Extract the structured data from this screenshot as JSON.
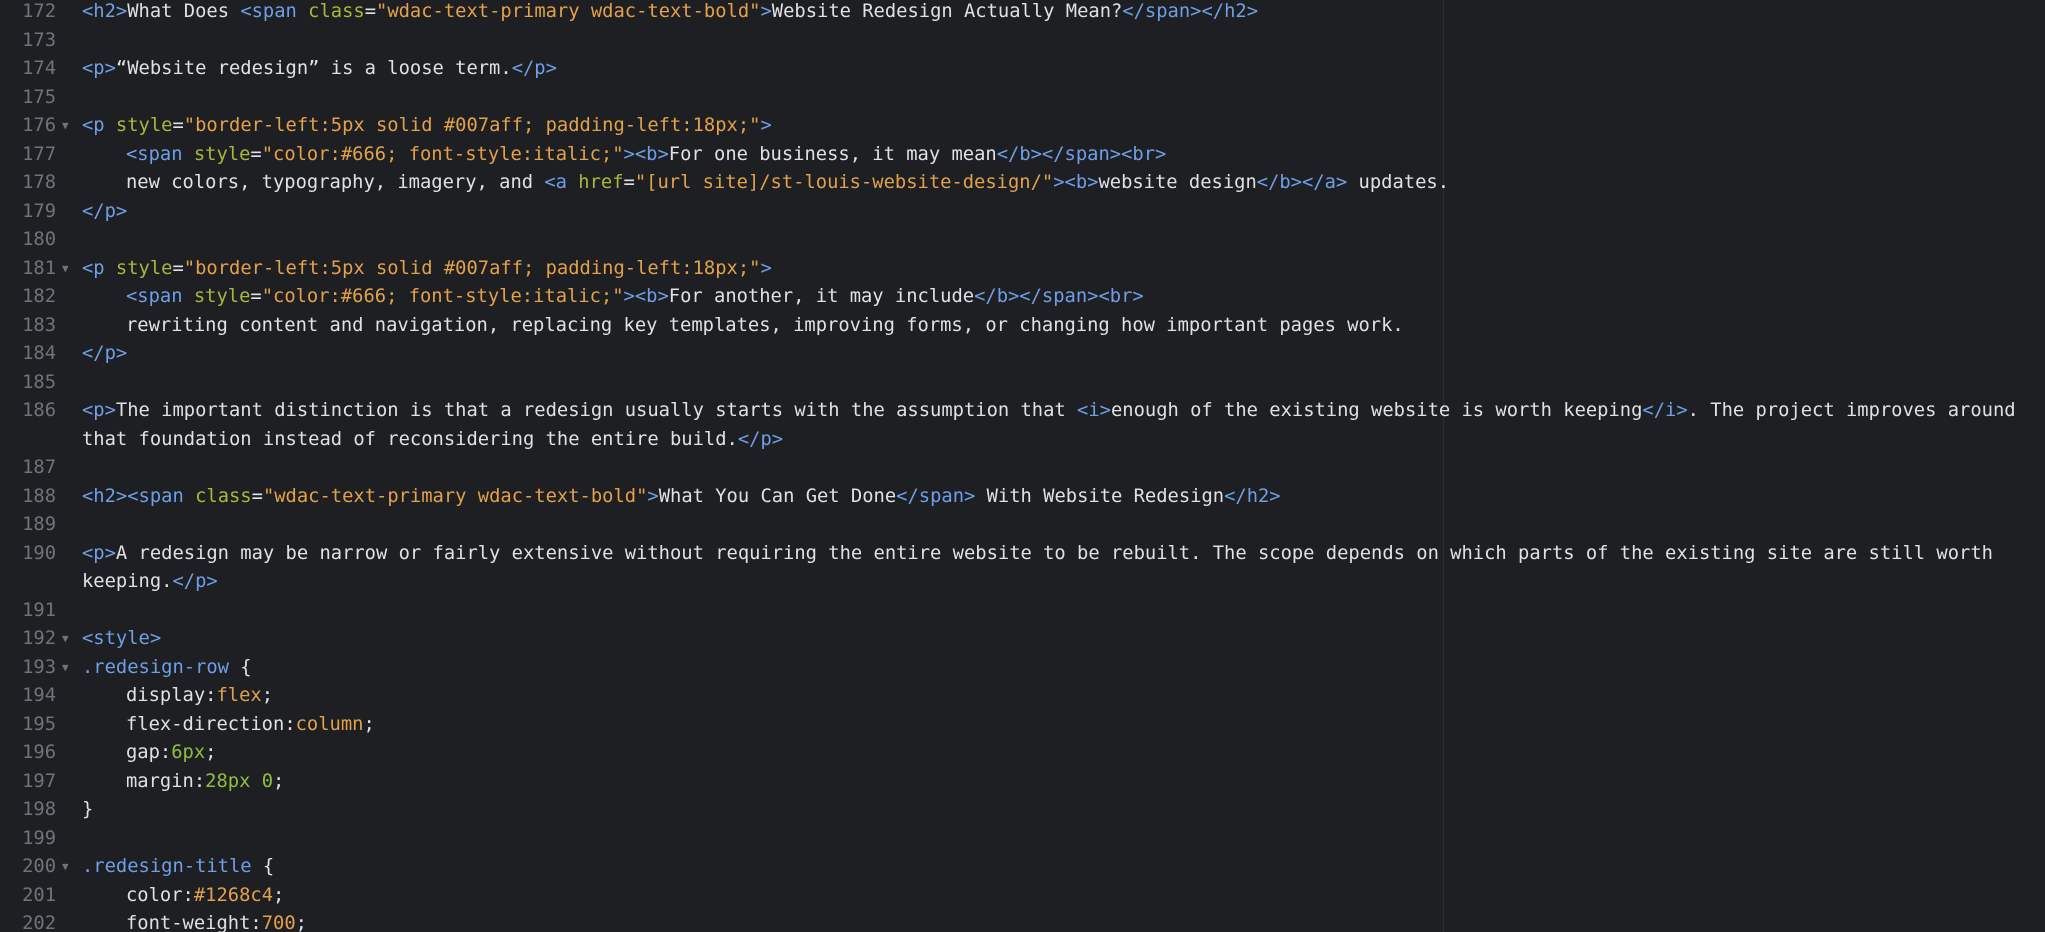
{
  "editor": {
    "lines": [
      {
        "n": "172",
        "fold": false,
        "indent": 0,
        "tokens": [
          [
            "tag",
            "<h2>"
          ],
          [
            "text",
            "What Does "
          ],
          [
            "tag",
            "<span "
          ],
          [
            "attr",
            "class"
          ],
          [
            "text",
            "="
          ],
          [
            "str",
            "\"wdac-text-primary wdac-text-bold\""
          ],
          [
            "tag",
            ">"
          ],
          [
            "text",
            "Website Redesign Actually Mean?"
          ],
          [
            "tag",
            "</span></h2>"
          ]
        ]
      },
      {
        "n": "173",
        "fold": false,
        "indent": 0,
        "tokens": []
      },
      {
        "n": "174",
        "fold": false,
        "indent": 0,
        "tokens": [
          [
            "tag",
            "<p>"
          ],
          [
            "text",
            "“Website redesign” is a loose term."
          ],
          [
            "tag",
            "</p>"
          ]
        ]
      },
      {
        "n": "175",
        "fold": false,
        "indent": 0,
        "tokens": []
      },
      {
        "n": "176",
        "fold": true,
        "indent": 0,
        "tokens": [
          [
            "tag",
            "<p "
          ],
          [
            "attr",
            "style"
          ],
          [
            "text",
            "="
          ],
          [
            "str",
            "\"border-left:5px solid #007aff; padding-left:18px;\""
          ],
          [
            "tag",
            ">"
          ]
        ]
      },
      {
        "n": "177",
        "fold": false,
        "indent": 1,
        "tokens": [
          [
            "tag",
            "<span "
          ],
          [
            "attr",
            "style"
          ],
          [
            "text",
            "="
          ],
          [
            "str",
            "\"color:#666; font-style:italic;\""
          ],
          [
            "tag",
            "><b>"
          ],
          [
            "text",
            "For one business, it may mean"
          ],
          [
            "tag",
            "</b></span><br>"
          ]
        ]
      },
      {
        "n": "178",
        "fold": false,
        "indent": 1,
        "tokens": [
          [
            "text",
            "new colors, typography, imagery, and "
          ],
          [
            "tag",
            "<a "
          ],
          [
            "attr",
            "href"
          ],
          [
            "text",
            "="
          ],
          [
            "str",
            "\"[url site]/st-louis-website-design/\""
          ],
          [
            "tag",
            "><b>"
          ],
          [
            "text",
            "website design"
          ],
          [
            "tag",
            "</b></a>"
          ],
          [
            "text",
            " updates."
          ]
        ]
      },
      {
        "n": "179",
        "fold": false,
        "indent": 0,
        "tokens": [
          [
            "tag",
            "</p>"
          ]
        ]
      },
      {
        "n": "180",
        "fold": false,
        "indent": 0,
        "tokens": []
      },
      {
        "n": "181",
        "fold": true,
        "indent": 0,
        "tokens": [
          [
            "tag",
            "<p "
          ],
          [
            "attr",
            "style"
          ],
          [
            "text",
            "="
          ],
          [
            "str",
            "\"border-left:5px solid #007aff; padding-left:18px;\""
          ],
          [
            "tag",
            ">"
          ]
        ]
      },
      {
        "n": "182",
        "fold": false,
        "indent": 1,
        "tokens": [
          [
            "tag",
            "<span "
          ],
          [
            "attr",
            "style"
          ],
          [
            "text",
            "="
          ],
          [
            "str",
            "\"color:#666; font-style:italic;\""
          ],
          [
            "tag",
            "><b>"
          ],
          [
            "text",
            "For another, it may include"
          ],
          [
            "tag",
            "</b></span><br>"
          ]
        ]
      },
      {
        "n": "183",
        "fold": false,
        "indent": 1,
        "tokens": [
          [
            "text",
            "rewriting content and navigation, replacing key templates, improving forms, or changing how important pages work."
          ]
        ]
      },
      {
        "n": "184",
        "fold": false,
        "indent": 0,
        "tokens": [
          [
            "tag",
            "</p>"
          ]
        ]
      },
      {
        "n": "185",
        "fold": false,
        "indent": 0,
        "tokens": []
      },
      {
        "n": "186",
        "fold": false,
        "indent": 0,
        "wrap": true,
        "tokens": [
          [
            "tag",
            "<p>"
          ],
          [
            "text",
            "The important distinction is that a redesign usually starts with the assumption that "
          ],
          [
            "tag",
            "<i>"
          ],
          [
            "text",
            "enough of the existing website is worth keeping"
          ],
          [
            "tag",
            "</i>"
          ],
          [
            "text",
            ". The project improves around that foundation instead of reconsidering the entire build."
          ],
          [
            "tag",
            "</p>"
          ]
        ]
      },
      {
        "n": "187",
        "fold": false,
        "indent": 0,
        "tokens": []
      },
      {
        "n": "188",
        "fold": false,
        "indent": 0,
        "tokens": [
          [
            "tag",
            "<h2><span "
          ],
          [
            "attr",
            "class"
          ],
          [
            "text",
            "="
          ],
          [
            "str",
            "\"wdac-text-primary wdac-text-bold\""
          ],
          [
            "tag",
            ">"
          ],
          [
            "text",
            "What You Can Get Done"
          ],
          [
            "tag",
            "</span>"
          ],
          [
            "text",
            " With Website Redesign"
          ],
          [
            "tag",
            "</h2>"
          ]
        ]
      },
      {
        "n": "189",
        "fold": false,
        "indent": 0,
        "tokens": []
      },
      {
        "n": "190",
        "fold": false,
        "indent": 0,
        "wrap": true,
        "tokens": [
          [
            "tag",
            "<p>"
          ],
          [
            "text",
            "A redesign may be narrow or fairly extensive without requiring the entire website to be rebuilt. The scope depends on which parts of the existing site are still worth keeping."
          ],
          [
            "tag",
            "</p>"
          ]
        ]
      },
      {
        "n": "191",
        "fold": false,
        "indent": 0,
        "tokens": []
      },
      {
        "n": "192",
        "fold": true,
        "indent": 0,
        "tokens": [
          [
            "tag",
            "<style>"
          ]
        ]
      },
      {
        "n": "193",
        "fold": true,
        "indent": 0,
        "tokens": [
          [
            "sel",
            ".redesign-row"
          ],
          [
            "text",
            " {"
          ]
        ]
      },
      {
        "n": "194",
        "fold": false,
        "indent": 1,
        "tokens": [
          [
            "prop",
            "display"
          ],
          [
            "text",
            ":"
          ],
          [
            "val",
            "flex"
          ],
          [
            "text",
            ";"
          ]
        ]
      },
      {
        "n": "195",
        "fold": false,
        "indent": 1,
        "tokens": [
          [
            "prop",
            "flex-direction"
          ],
          [
            "text",
            ":"
          ],
          [
            "val",
            "column"
          ],
          [
            "text",
            ";"
          ]
        ]
      },
      {
        "n": "196",
        "fold": false,
        "indent": 1,
        "tokens": [
          [
            "prop",
            "gap"
          ],
          [
            "text",
            ":"
          ],
          [
            "num",
            "6px"
          ],
          [
            "text",
            ";"
          ]
        ]
      },
      {
        "n": "197",
        "fold": false,
        "indent": 1,
        "tokens": [
          [
            "prop",
            "margin"
          ],
          [
            "text",
            ":"
          ],
          [
            "num",
            "28px 0"
          ],
          [
            "text",
            ";"
          ]
        ]
      },
      {
        "n": "198",
        "fold": false,
        "indent": 0,
        "tokens": [
          [
            "text",
            "}"
          ]
        ]
      },
      {
        "n": "199",
        "fold": false,
        "indent": 0,
        "tokens": []
      },
      {
        "n": "200",
        "fold": true,
        "indent": 0,
        "tokens": [
          [
            "sel",
            ".redesign-title"
          ],
          [
            "text",
            " {"
          ]
        ]
      },
      {
        "n": "201",
        "fold": false,
        "indent": 1,
        "tokens": [
          [
            "prop",
            "color"
          ],
          [
            "text",
            ":"
          ],
          [
            "val",
            "#1268c4"
          ],
          [
            "text",
            ";"
          ]
        ]
      },
      {
        "n": "202",
        "fold": false,
        "indent": 1,
        "tokens": [
          [
            "prop",
            "font-weight"
          ],
          [
            "text",
            ":"
          ],
          [
            "val",
            "700"
          ],
          [
            "text",
            ";"
          ]
        ]
      }
    ]
  },
  "icons": {
    "fold": "fold-triangle-icon"
  },
  "colors": {
    "background": "#1e1f22",
    "tag": "#6f9fe8",
    "attr": "#a7b83b",
    "string": "#e3a14b",
    "text": "#dfe1e5",
    "number": "#8fbf3f",
    "gutter": "#6f737a"
  }
}
